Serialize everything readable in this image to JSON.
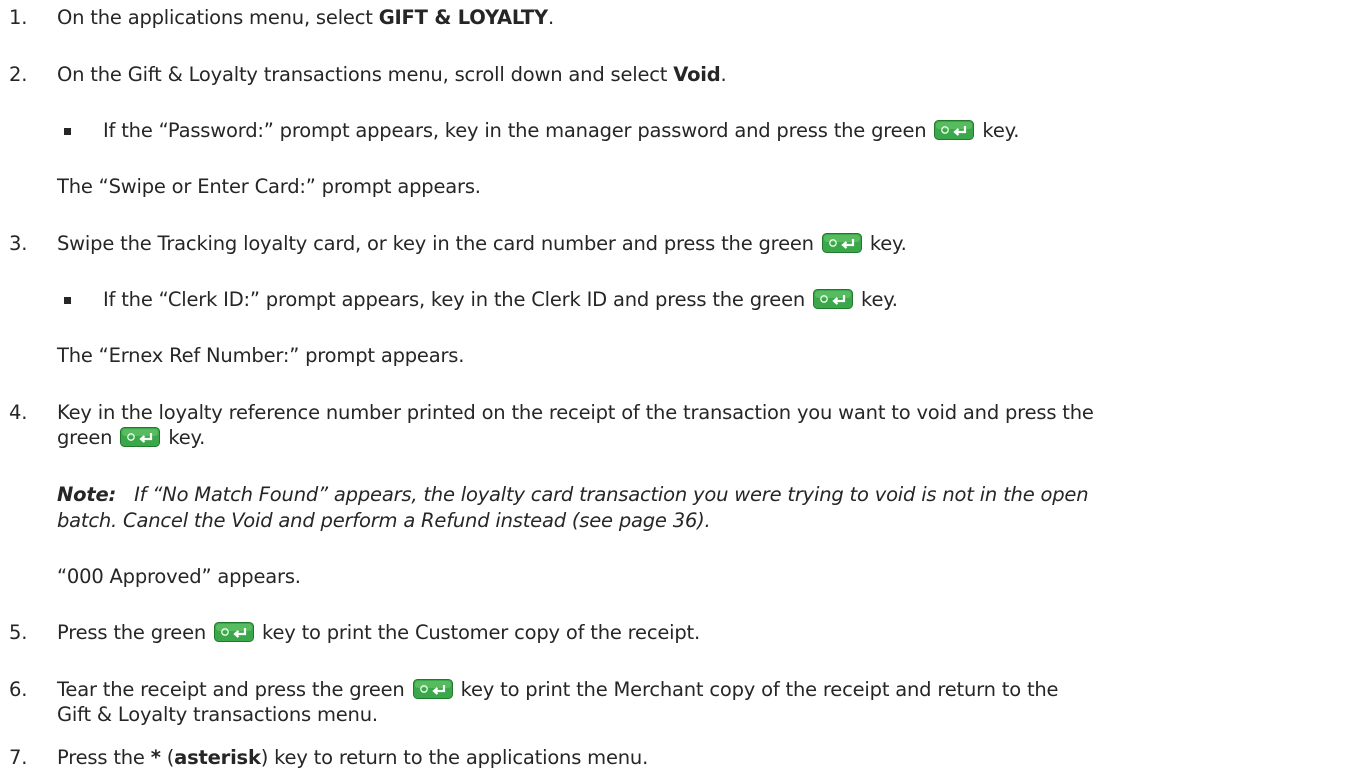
{
  "steps": [
    {
      "num": "1.",
      "pre": "On the applications menu, select ",
      "bold": "GIFT & LOYALTY",
      "post": "."
    },
    {
      "num": "2.",
      "pre": "On the Gift & Loyalty transactions menu, scroll down and select ",
      "bold": "Void",
      "post": "."
    },
    {
      "bullet_pre": "If the “Password:” prompt appears, key in the manager password and press the green ",
      "bullet_post": " key."
    },
    {
      "text": "The “Swipe or Enter Card:” prompt appears."
    },
    {
      "num": "3.",
      "pre": "Swipe the Tracking loyalty card, or key in the card number and press the green ",
      "post": " key."
    },
    {
      "bullet_pre": "If the “Clerk ID:” prompt appears, key in the Clerk ID and press the green ",
      "bullet_post": " key."
    },
    {
      "text": "The “Ernex Ref Number:” prompt appears."
    },
    {
      "num": "4.",
      "line1": "Key in the loyalty reference number printed on the receipt of the transaction you want to void and press the",
      "line2_pre": "green ",
      "line2_post": " key."
    },
    {
      "note_label": "Note:",
      "note_line1": "If “No Match Found” appears, the loyalty card transaction you were trying to void is not in the open",
      "note_line2": "batch. Cancel the Void and perform a Refund instead (see page 36)."
    },
    {
      "text": "“000 Approved” appears."
    },
    {
      "num": "5.",
      "pre": "Press the green ",
      "post": " key to print the Customer copy of the receipt."
    },
    {
      "num": "6.",
      "pre": "Tear the receipt and press the green ",
      "post": " key to print the Merchant copy of the receipt and return to the",
      "line2": "Gift & Loyalty transactions menu."
    },
    {
      "num": "7.",
      "pre": "Press the ",
      "bold": "*",
      "mid": " (",
      "bold2": "asterisk",
      "post": ") key to return to the applications menu."
    }
  ],
  "icons": {
    "enter_key": "green-enter-key-icon"
  },
  "colors": {
    "key_green": "#3aa84a",
    "key_dark": "#1f7a2c",
    "text": "#262626"
  }
}
